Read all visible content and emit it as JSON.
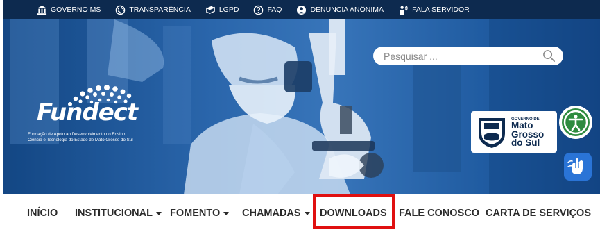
{
  "topbar": {
    "items": [
      {
        "label": "GOVERNO MS",
        "icon": "government-building-icon"
      },
      {
        "label": "TRANSPARÊNCIA",
        "icon": "globe-icon"
      },
      {
        "label": "LGPD",
        "icon": "book-icon"
      },
      {
        "label": "FAQ",
        "icon": "question-icon"
      },
      {
        "label": "DENUNCIA ANÔNIMA",
        "icon": "anonymous-user-icon"
      },
      {
        "label": "FALA SERVIDOR",
        "icon": "speaking-person-icon"
      }
    ]
  },
  "search": {
    "placeholder": "Pesquisar ...",
    "icon": "search-icon"
  },
  "logo": {
    "name": "Fundect",
    "subtitle_line1": "Fundação de Apoio ao Desenvolvimento do Ensino,",
    "subtitle_line2": "Ciência e Tecnologia do Estado de Mato Grosso do Sul"
  },
  "government_logo": {
    "prefix": "GOVERNO DE",
    "name": "Mato Grosso do Sul"
  },
  "accessibility": {
    "icon": "accessibility-icon",
    "sign_language_icon": "sign-language-icon"
  },
  "nav": {
    "items": [
      {
        "label": "INÍCIO",
        "dropdown": false
      },
      {
        "label": "INSTITUCIONAL",
        "dropdown": true
      },
      {
        "label": "FOMENTO",
        "dropdown": true
      },
      {
        "label": "CHAMADAS",
        "dropdown": true
      },
      {
        "label": "DOWNLOADS",
        "dropdown": false,
        "highlighted": true
      },
      {
        "label": "FALE CONOSCO",
        "dropdown": false
      },
      {
        "label": "CARTA DE SERVIÇOS",
        "dropdown": false
      }
    ]
  },
  "colors": {
    "topbar": "#0d2a4f",
    "hero": "#2a67ad",
    "highlight": "#e01010",
    "accessibility": "#2e8b3f",
    "libras": "#2a74d6"
  }
}
